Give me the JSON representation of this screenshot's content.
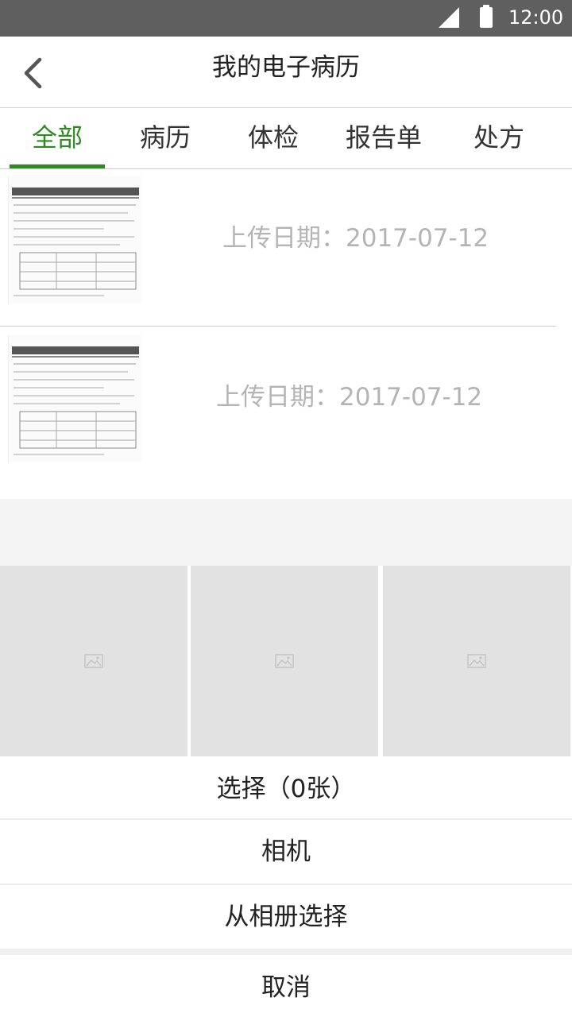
{
  "status_bar": {
    "time": "12:00",
    "icons": [
      "signal-icon",
      "battery-icon"
    ]
  },
  "header": {
    "title": "我的电子病历",
    "back_icon": "chevron-left-icon"
  },
  "tabs": [
    {
      "label": "全部",
      "active": true
    },
    {
      "label": "病历",
      "active": false
    },
    {
      "label": "体检",
      "active": false
    },
    {
      "label": "报告单",
      "active": false
    },
    {
      "label": "处方",
      "active": false
    }
  ],
  "records": [
    {
      "date": "上传日期：2017-07-12"
    },
    {
      "date": "上传日期：2017-07-12"
    }
  ],
  "photo_picker": {
    "placeholder_icon": "image-placeholder-icon",
    "tiles": 3
  },
  "action_sheet": {
    "select_label": "选择（0张）",
    "camera_label": "相机",
    "album_label": "从相册选择",
    "cancel_label": "取消"
  },
  "colors": {
    "accent": "#2e8b1f",
    "status_bar": "#5f5f5f",
    "date_text": "#b4b4b4",
    "tile_placeholder": "#e2e2e2"
  }
}
